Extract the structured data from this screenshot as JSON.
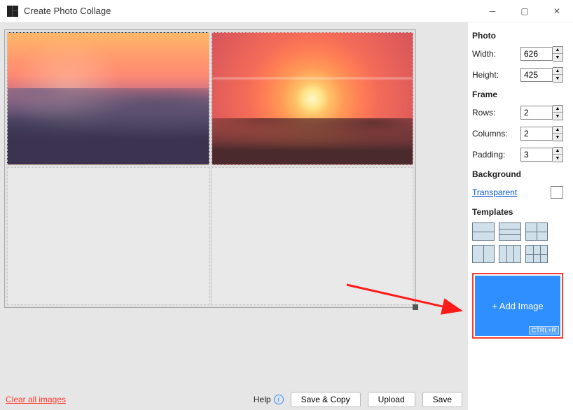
{
  "window": {
    "title": "Create Photo Collage",
    "minimize": "–",
    "maximize": "▢",
    "close": "✕"
  },
  "photo": {
    "heading": "Photo",
    "width_label": "Width:",
    "width_value": "626",
    "height_label": "Height:",
    "height_value": "425"
  },
  "frame": {
    "heading": "Frame",
    "rows_label": "Rows:",
    "rows_value": "2",
    "columns_label": "Columns:",
    "columns_value": "2",
    "padding_label": "Padding:",
    "padding_value": "3"
  },
  "background": {
    "heading": "Background",
    "transparent_label": "Transparent"
  },
  "templates": {
    "heading": "Templates"
  },
  "add_image": {
    "label": "+ Add Image",
    "shortcut": "CTRL+R"
  },
  "footer": {
    "clear_label": "Clear all images",
    "help_label": "Help",
    "save_copy_label": "Save & Copy",
    "upload_label": "Upload",
    "save_label": "Save"
  }
}
